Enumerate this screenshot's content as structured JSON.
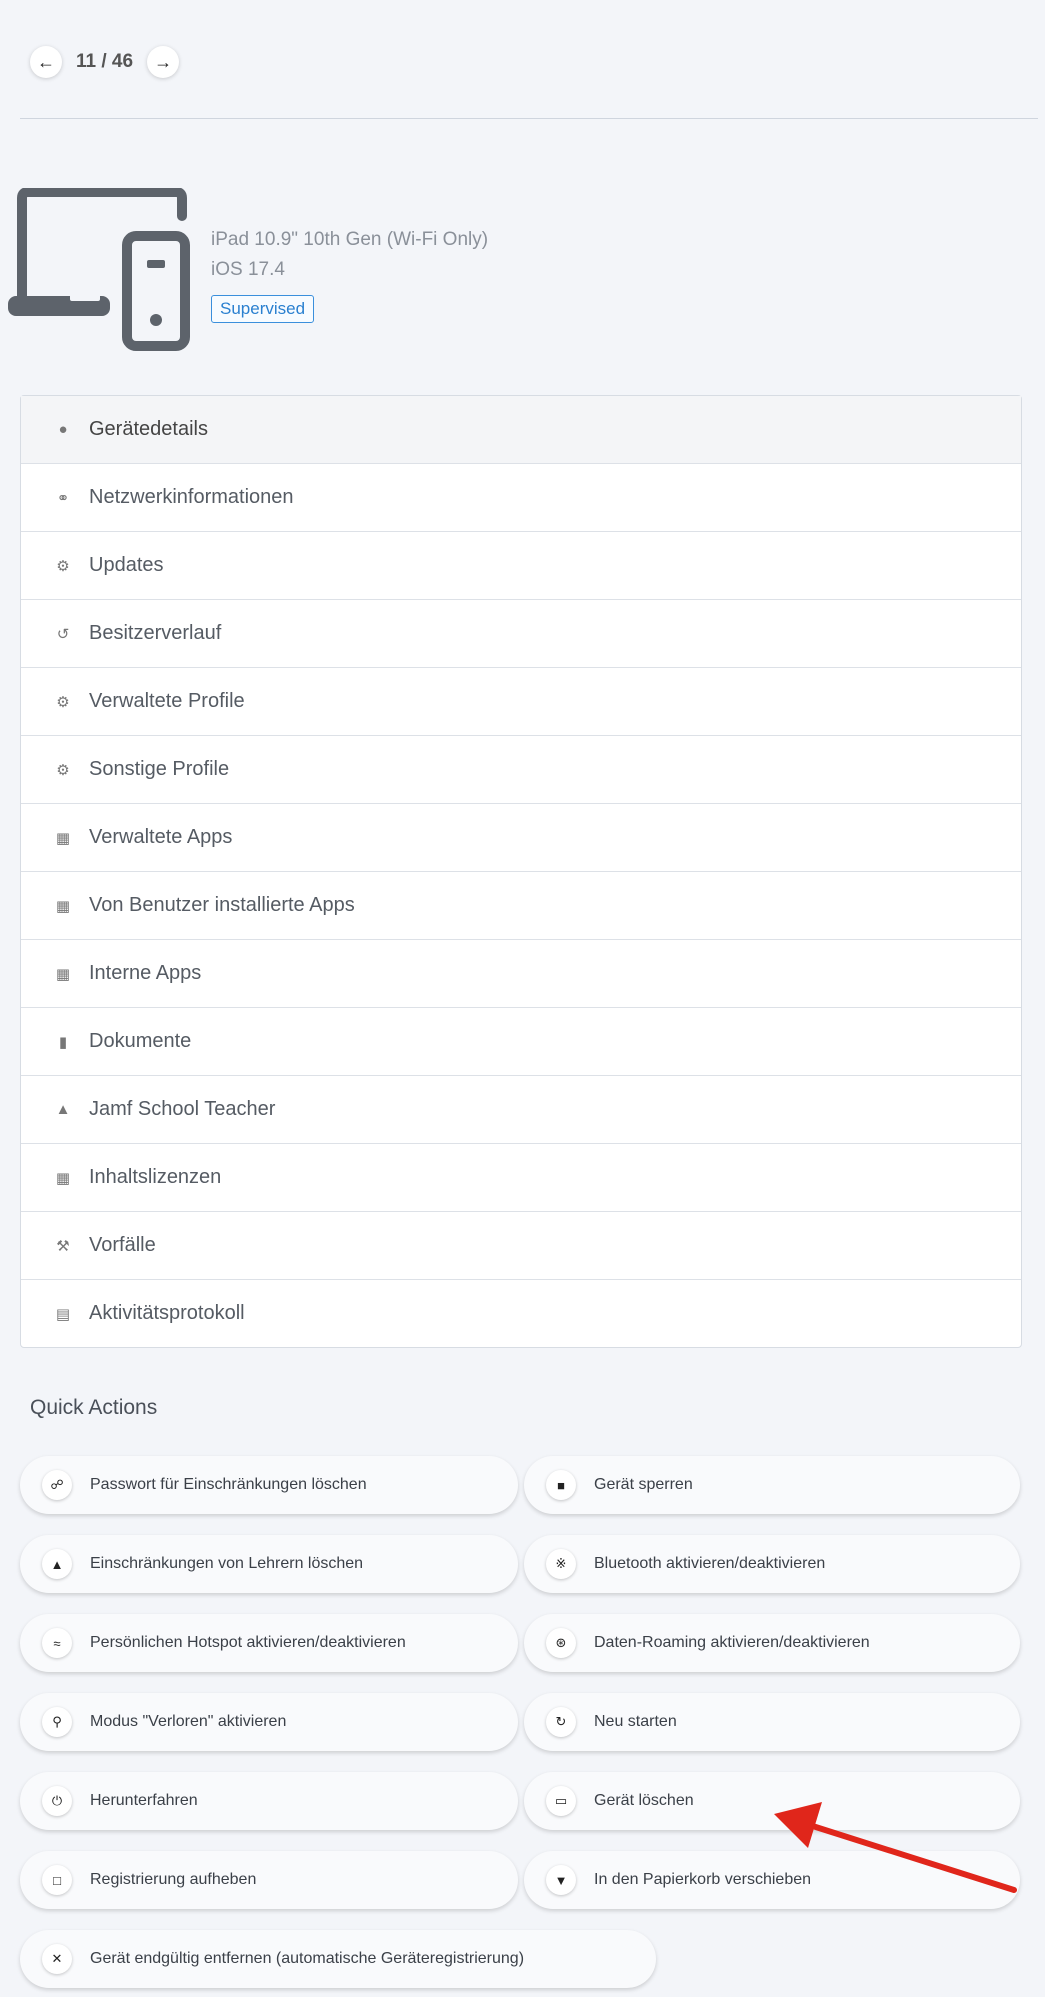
{
  "pager": {
    "prev_icon": "arrow-left-icon",
    "count": "11 / 46",
    "next_icon": "arrow-right-icon"
  },
  "device": {
    "icon": "laptop-phone-icon",
    "model": "iPad 10.9\" 10th Gen (Wi-Fi Only)",
    "os": "iOS 17.4",
    "status_badge": "Supervised",
    "badge_color": "#2a80d0"
  },
  "menu": {
    "items": [
      {
        "label": "Gerätedetails",
        "icon": "apple-icon"
      },
      {
        "label": "Netzwerkinformationen",
        "icon": "network-icon"
      },
      {
        "label": "Updates",
        "icon": "gears-icon"
      },
      {
        "label": "Besitzerverlauf",
        "icon": "history-icon"
      },
      {
        "label": "Verwaltete Profile",
        "icon": "gears-icon"
      },
      {
        "label": "Sonstige Profile",
        "icon": "gears-icon"
      },
      {
        "label": "Verwaltete Apps",
        "icon": "app-grid-icon"
      },
      {
        "label": "Von Benutzer installierte Apps",
        "icon": "app-grid-icon"
      },
      {
        "label": "Interne Apps",
        "icon": "app-grid-icon"
      },
      {
        "label": "Dokumente",
        "icon": "books-icon"
      },
      {
        "label": "Jamf School Teacher",
        "icon": "graduation-cap-icon"
      },
      {
        "label": "Inhaltslizenzen",
        "icon": "app-grid-icon"
      },
      {
        "label": "Vorfälle",
        "icon": "hammer-icon"
      },
      {
        "label": "Aktivitätsprotokoll",
        "icon": "document-icon"
      }
    ]
  },
  "quick_actions": {
    "title": "Quick Actions",
    "buttons": [
      {
        "label": "Passwort für Einschränkungen löschen",
        "icon": "unlock-icon"
      },
      {
        "label": "Gerät sperren",
        "icon": "lock-icon"
      },
      {
        "label": "Einschränkungen von Lehrern löschen",
        "icon": "graduation-cap-icon"
      },
      {
        "label": "Bluetooth aktivieren/deaktivieren",
        "icon": "bluetooth-icon"
      },
      {
        "label": "Persönlichen Hotspot aktivieren/deaktivieren",
        "icon": "wifi-icon"
      },
      {
        "label": "Daten-Roaming aktivieren/deaktivieren",
        "icon": "antenna-icon"
      },
      {
        "label": "Modus \"Verloren\" aktivieren",
        "icon": "search-icon"
      },
      {
        "label": "Neu starten",
        "icon": "restart-icon"
      },
      {
        "label": "Herunterfahren",
        "icon": "power-icon"
      },
      {
        "label": "Gerät löschen",
        "icon": "trash-icon"
      },
      {
        "label": "Registrierung aufheben",
        "icon": "file-icon"
      },
      {
        "label": "In den Papierkorb verschieben",
        "icon": "bin-icon"
      },
      {
        "label": "Gerät endgültig entfernen (automatische Geräteregistrierung)",
        "icon": "close-icon"
      }
    ]
  },
  "annotation": {
    "arrow_color": "#e0261b"
  }
}
